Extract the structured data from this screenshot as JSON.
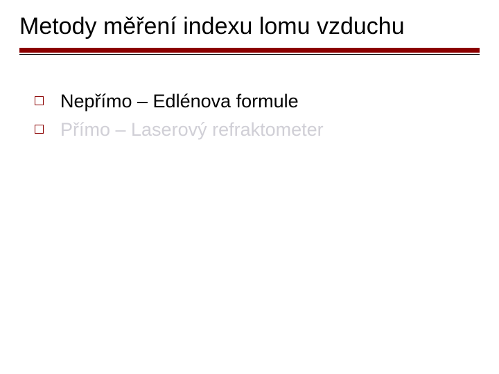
{
  "title": "Metody měření indexu lomu vzduchu",
  "bullets": [
    {
      "text": "Nepřímo – Edlénova formule",
      "faded": false
    },
    {
      "text": "Přímo – Laserový refraktometer",
      "faded": true
    }
  ],
  "colors": {
    "accent": "#8b0000",
    "faded": "#d0cfd6",
    "text": "#000000"
  }
}
